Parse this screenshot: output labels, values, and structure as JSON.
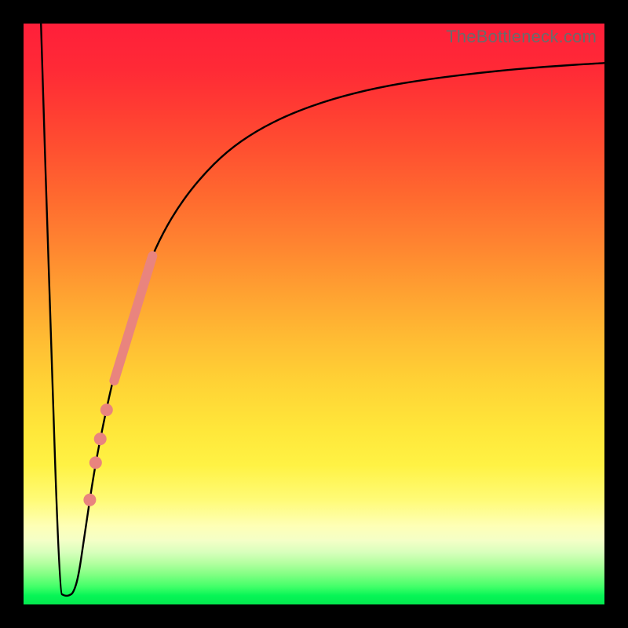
{
  "attribution": "TheBottleneck.com",
  "chart_data": {
    "type": "line",
    "title": "",
    "xlabel": "",
    "ylabel": "",
    "xlim": [
      0,
      100
    ],
    "ylim": [
      0,
      100
    ],
    "grid": false,
    "legend": false,
    "background": "vertical rainbow gradient (red top → green bottom)",
    "series": [
      {
        "name": "bottleneck-curve",
        "color": "#000000",
        "x": [
          3.0,
          4.6,
          6.2,
          7.0,
          7.8,
          8.6,
          9.5,
          10.5,
          12.0,
          13.5,
          15.0,
          16.5,
          18.0,
          19.5,
          21.5,
          24.0,
          27.0,
          30.5,
          35.0,
          40.0,
          46.0,
          53.0,
          61.0,
          70.0,
          80.0,
          90.0,
          100.0
        ],
        "y": [
          100,
          48.5,
          2.0,
          1.5,
          1.5,
          2.0,
          5.0,
          12.0,
          22.0,
          30.0,
          37.0,
          43.0,
          48.5,
          53.0,
          58.5,
          64.0,
          69.0,
          73.5,
          78.0,
          81.5,
          84.5,
          87.0,
          89.0,
          90.5,
          91.7,
          92.6,
          93.2
        ]
      }
    ],
    "highlight_band": {
      "name": "salmon-band",
      "color": "#e9847e",
      "stroke_width_px": 12,
      "x": [
        15.6,
        22.2
      ],
      "y": [
        38.5,
        60.0
      ]
    },
    "highlight_dots": {
      "name": "salmon-dots",
      "color": "#e9847e",
      "radius_px": 8,
      "points": [
        {
          "x": 14.3,
          "y": 33.5
        },
        {
          "x": 13.2,
          "y": 28.5
        },
        {
          "x": 12.4,
          "y": 24.4
        },
        {
          "x": 11.4,
          "y": 18.0
        }
      ]
    }
  }
}
